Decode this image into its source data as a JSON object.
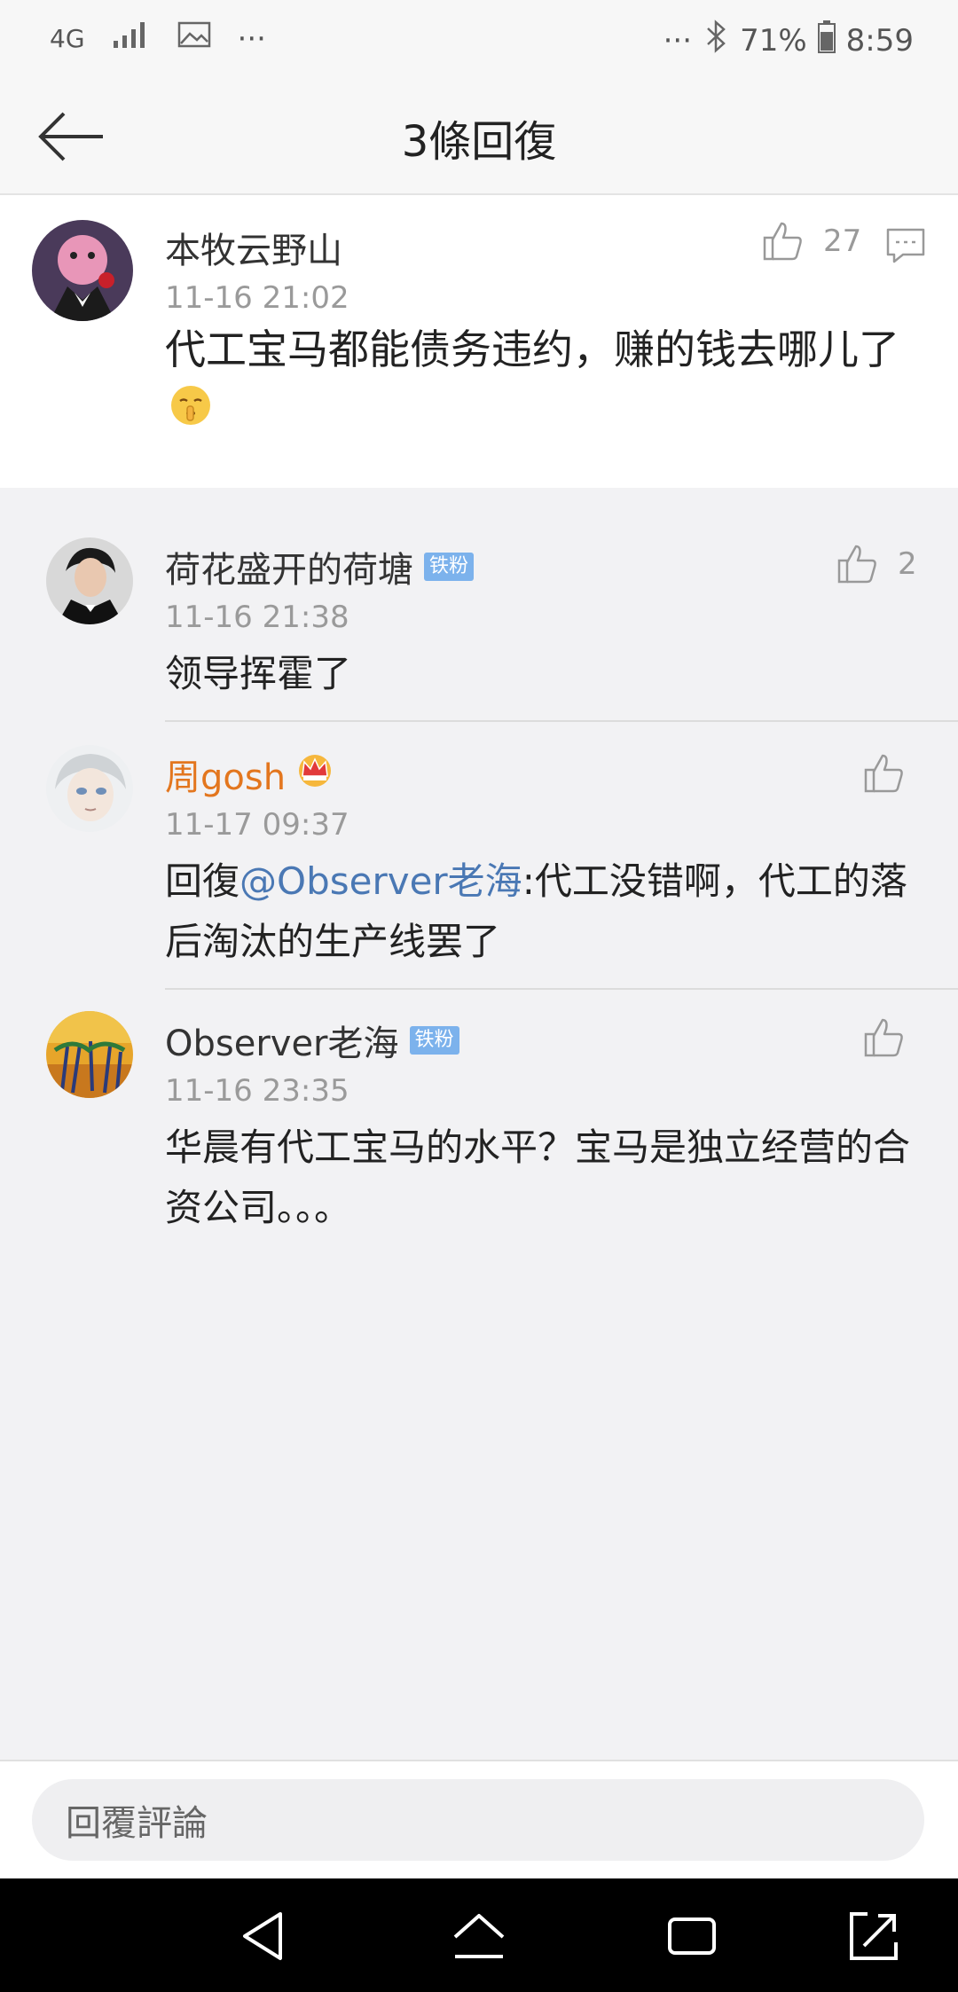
{
  "status_bar": {
    "network": "4G",
    "dots_left": "···",
    "dots_right": "···",
    "battery": "71%",
    "time": "8:59"
  },
  "header": {
    "title": "3條回復",
    "back_icon": "arrow-left-icon"
  },
  "main_comment": {
    "author": "本牧云野山",
    "time": "11-16 21:02",
    "text": "代工宝马都能债务违约，赚的钱去哪儿了",
    "emoji": "shushing-face",
    "likes": "27"
  },
  "replies": [
    {
      "author": "荷花盛开的荷塘",
      "badge": "铁粉",
      "time": "11-16 21:38",
      "text": "领导挥霍了",
      "likes": "2"
    },
    {
      "author": "周gosh",
      "author_color": "#e3761e",
      "badge_icon": "crown-icon",
      "time": "11-17 09:37",
      "prefix": "回復",
      "mention": "@Observer老海",
      "text": ":代工没错啊，代工的落后淘汰的生产线罢了",
      "likes": ""
    },
    {
      "author": "Observer老海",
      "badge": "铁粉",
      "time": "11-16 23:35",
      "text": "华晨有代工宝马的水平？宝马是独立经营的合资公司。。。",
      "likes": ""
    }
  ],
  "bottom": {
    "reply_placeholder": "回覆評論"
  },
  "colors": {
    "badge": "#7cb2ec",
    "mention": "#4a78b4",
    "highlight_name": "#e3761e"
  }
}
